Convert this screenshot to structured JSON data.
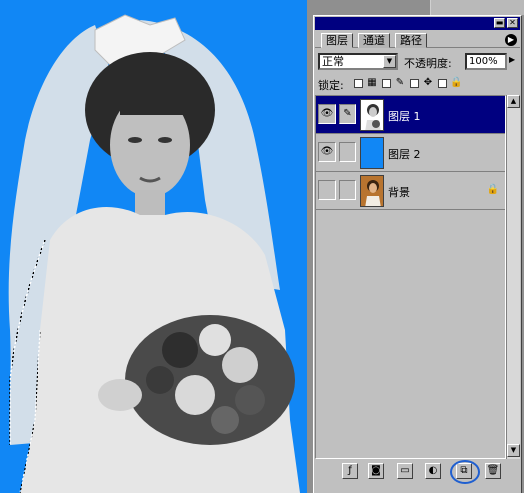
{
  "palette": {
    "tabs": [
      {
        "label": "图层",
        "active": true
      },
      {
        "label": "通道",
        "active": false
      },
      {
        "label": "路径",
        "active": false
      }
    ],
    "title_buttons": [
      "minimize",
      "close"
    ],
    "blend_mode": "正常",
    "opacity_label": "不透明度:",
    "opacity_value": "100%",
    "lock_label": "锁定:",
    "layers": [
      {
        "name": "图层 1",
        "visible": true,
        "selected": true,
        "thumb": "bride-photo"
      },
      {
        "name": "图层 2",
        "visible": true,
        "selected": false,
        "thumb": "blue-fill"
      },
      {
        "name": "背景",
        "visible": false,
        "selected": false,
        "thumb": "bride-photo-color",
        "locked": true
      }
    ],
    "bottom_buttons": [
      "layer-style",
      "layer-mask",
      "new-set",
      "new-fill-adjustment",
      "new-layer",
      "delete-layer"
    ]
  },
  "colors": {
    "canvas_bg": "#1187f5",
    "palette_bg": "#c0c0c0",
    "selection": "#000080",
    "highlight_ring": "#1f5fd0"
  }
}
